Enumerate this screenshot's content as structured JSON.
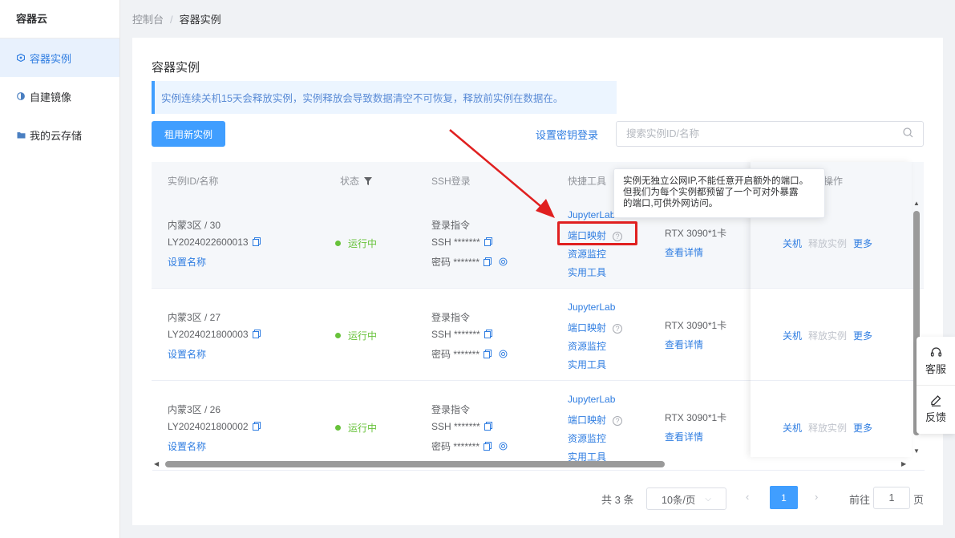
{
  "sidebar": {
    "brand": "容器云",
    "items": [
      {
        "label": "容器实例",
        "icon": "cube-icon",
        "active": true
      },
      {
        "label": "自建镜像",
        "icon": "image-icon",
        "active": false
      },
      {
        "label": "我的云存储",
        "icon": "folder-icon",
        "active": false
      }
    ]
  },
  "breadcrumb": {
    "root": "控制台",
    "separator": "/",
    "current": "容器实例"
  },
  "page": {
    "title": "容器实例",
    "notice": "实例连续关机15天会释放实例，实例释放会导致数据清空不可恢复，释放前实例在数据在。",
    "rent_button": "租用新实例",
    "key_login_link": "设置密钥登录",
    "search_placeholder": "搜索实例ID/名称"
  },
  "table": {
    "headers": {
      "id": "实例ID/名称",
      "status": "状态",
      "ssh": "SSH登录",
      "tools": "快捷工具",
      "ops": "操作"
    },
    "rows": [
      {
        "region": "内蒙3区 / 30",
        "id": "LY2024022600013",
        "set_name": "设置名称",
        "status": "运行中",
        "login_cmd": "登录指令",
        "ssh": "SSH *******",
        "password": "密码 *******",
        "jupyter": "JupyterLab",
        "port_map": "端口映射",
        "monitor": "资源监控",
        "utils": "实用工具",
        "gpu": "RTX 3090*1卡",
        "detail": "查看详情",
        "shutdown": "关机",
        "release": "释放实例",
        "more": "更多"
      },
      {
        "region": "内蒙3区 / 27",
        "id": "LY2024021800003",
        "set_name": "设置名称",
        "status": "运行中",
        "login_cmd": "登录指令",
        "ssh": "SSH *******",
        "password": "密码 *******",
        "jupyter": "JupyterLab",
        "port_map": "端口映射",
        "monitor": "资源监控",
        "utils": "实用工具",
        "gpu": "RTX 3090*1卡",
        "detail": "查看详情",
        "shutdown": "关机",
        "release": "释放实例",
        "more": "更多"
      },
      {
        "region": "内蒙3区 / 26",
        "id": "LY2024021800002",
        "set_name": "设置名称",
        "status": "运行中",
        "login_cmd": "登录指令",
        "ssh": "SSH *******",
        "password": "密码 *******",
        "jupyter": "JupyterLab",
        "port_map": "端口映射",
        "monitor": "资源监控",
        "utils": "实用工具",
        "gpu": "RTX 3090*1卡",
        "detail": "查看详情",
        "shutdown": "关机",
        "release": "释放实例",
        "more": "更多"
      }
    ]
  },
  "tooltip": {
    "line1": "实例无独立公网IP,不能任意开启额外的端口。",
    "line2": "但我们为每个实例都预留了一个可对外暴露",
    "line3": "的端口,可供外网访问。"
  },
  "pagination": {
    "total": "共 3 条",
    "page_size": "10条/页",
    "current_page": "1",
    "goto_label": "前往",
    "goto_value": "1",
    "page_suffix": "页"
  },
  "float": {
    "service": "客服",
    "feedback": "反馈"
  },
  "colors": {
    "primary": "#409eff",
    "link": "#2f7de1",
    "success": "#67c23a",
    "annotation": "#e02020"
  }
}
